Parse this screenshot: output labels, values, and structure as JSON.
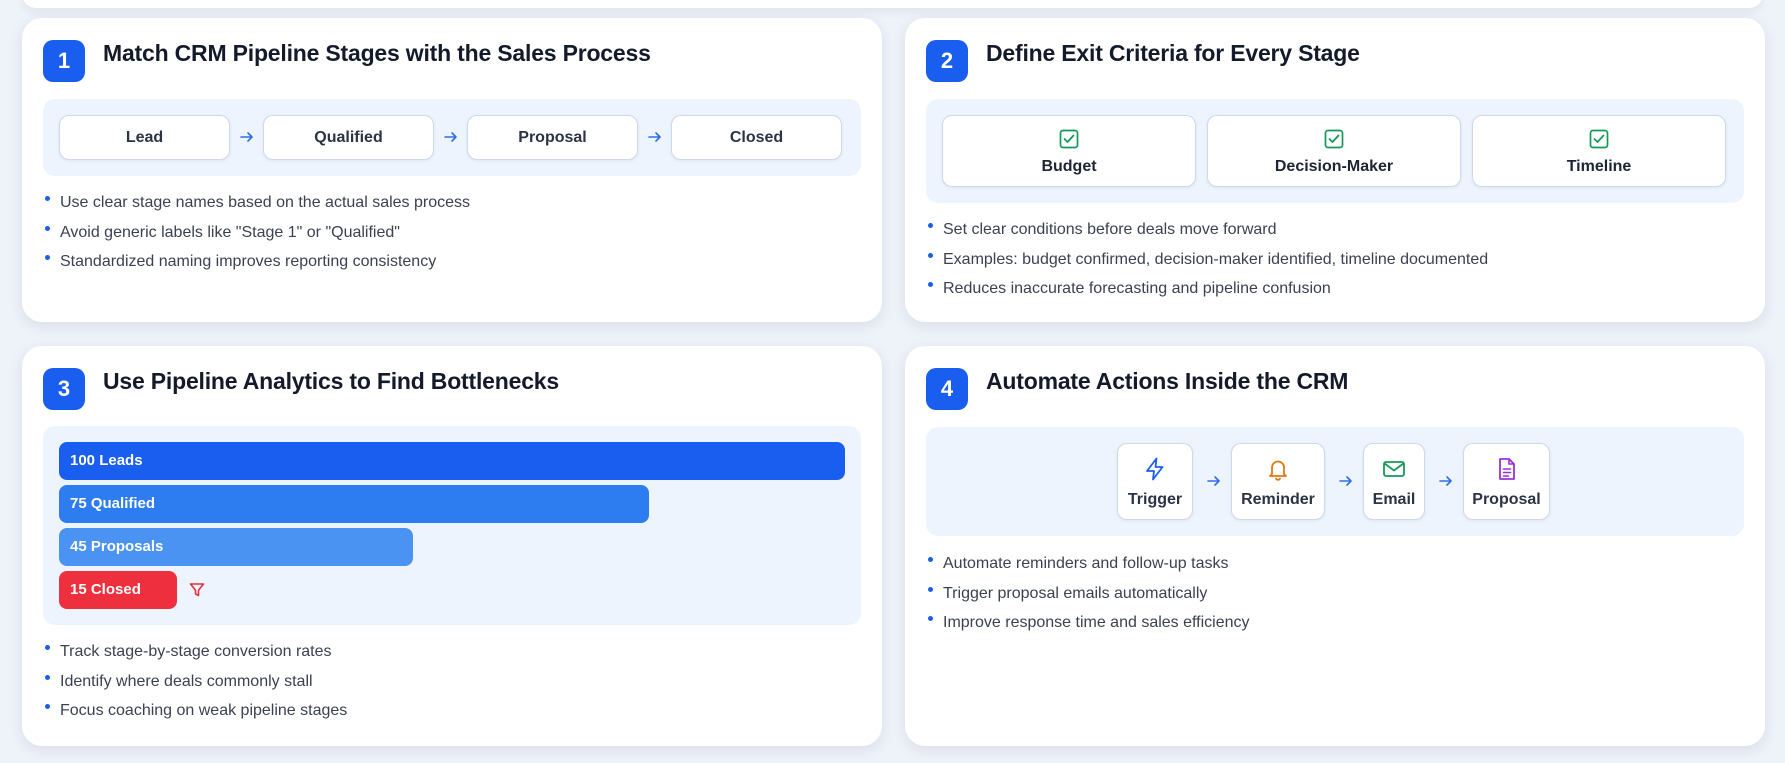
{
  "card1": {
    "number": "1",
    "title": "Match CRM Pipeline Stages with the Sales Process",
    "stages": [
      "Lead",
      "Qualified",
      "Proposal",
      "Closed"
    ],
    "bullets": [
      "Use clear stage names based on the actual sales process",
      "Avoid generic labels like \"Stage 1\" or \"Qualified\"",
      "Standardized naming improves reporting consistency"
    ]
  },
  "card2": {
    "number": "2",
    "title": "Define Exit Criteria for Every Stage",
    "criteria": [
      "Budget",
      "Decision-Maker",
      "Timeline"
    ],
    "bullets": [
      "Set clear conditions before deals move forward",
      "Examples: budget confirmed, decision-maker identified, timeline documented",
      "Reduces inaccurate forecasting and pipeline confusion"
    ]
  },
  "card3": {
    "number": "3",
    "title": "Use Pipeline Analytics to Find Bottlenecks",
    "funnel": [
      {
        "label": "100 Leads",
        "value": 100,
        "color": "#1a5ef0"
      },
      {
        "label": "75 Qualified",
        "value": 75,
        "color": "#2e7df0"
      },
      {
        "label": "45 Proposals",
        "value": 45,
        "color": "#4b93f2"
      },
      {
        "label": "15 Closed",
        "value": 15,
        "color": "#ee2f3d"
      }
    ],
    "bullets": [
      "Track stage-by-stage conversion rates",
      "Identify where deals commonly stall",
      "Focus coaching on weak pipeline stages"
    ]
  },
  "card4": {
    "number": "4",
    "title": "Automate Actions Inside the CRM",
    "steps": [
      {
        "label": "Trigger",
        "icon": "lightning-icon",
        "color": "#1a5ef0"
      },
      {
        "label": "Reminder",
        "icon": "bell-icon",
        "color": "#e07a10"
      },
      {
        "label": "Email",
        "icon": "mail-icon",
        "color": "#159957"
      },
      {
        "label": "Proposal",
        "icon": "document-icon",
        "color": "#9b30d9"
      }
    ],
    "bullets": [
      "Automate reminders and follow-up tasks",
      "Trigger proposal emails automatically",
      "Improve response time and sales efficiency"
    ]
  },
  "colors": {
    "accent": "#1a5ef0",
    "check": "#159957",
    "danger": "#ee2f3d",
    "panel": "#eef4fd"
  }
}
